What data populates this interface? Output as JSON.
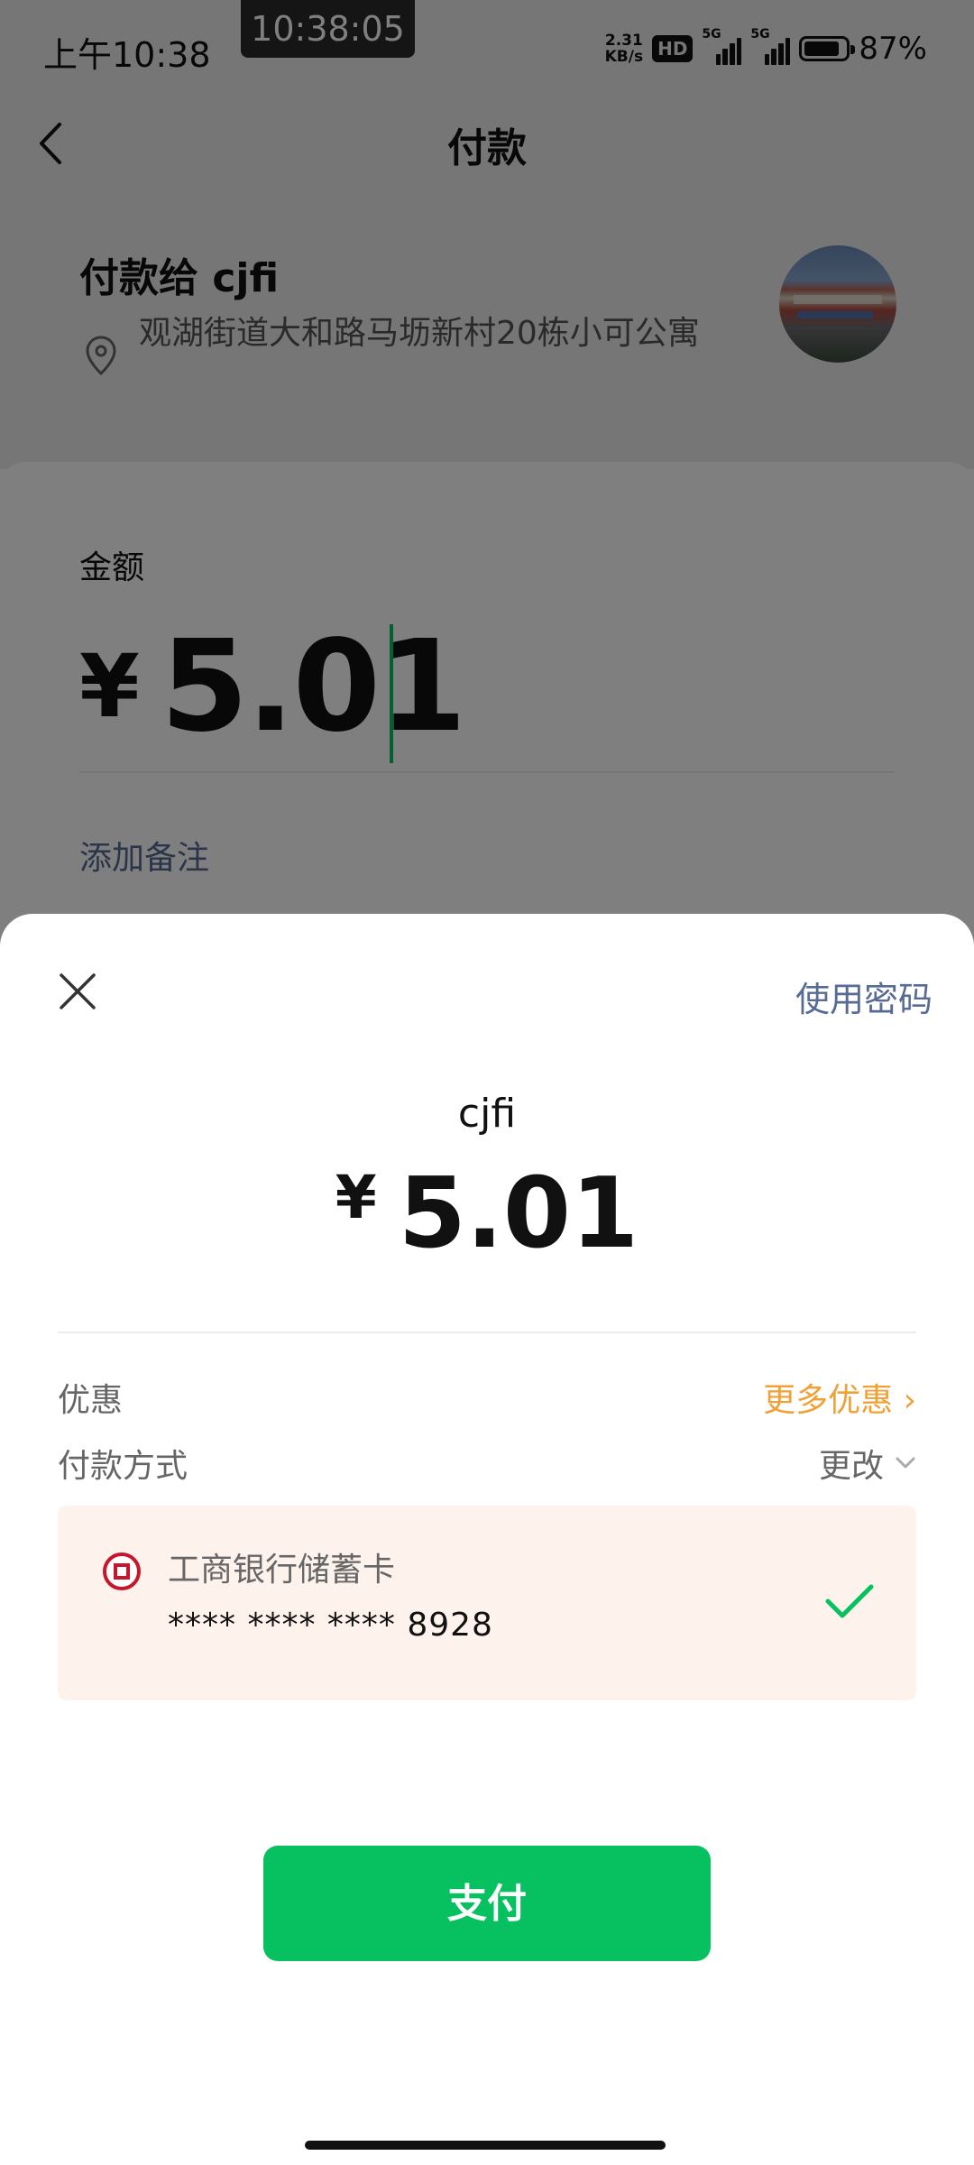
{
  "status_bar": {
    "time": "上午10:38",
    "clock_badge": "10:38:05",
    "net_speed_value": "2.31",
    "net_speed_unit": "KB/s",
    "hd_badge": "HD",
    "signal_label_1": "5G",
    "signal_label_2": "5G",
    "battery_percent": "87%",
    "battery_level": 0.87
  },
  "nav": {
    "title": "付款",
    "back_icon": "chevron-left-icon"
  },
  "payee": {
    "title": "付款给 cjfi",
    "address": "观湖街道大和路马坜新村20栋小可公寓",
    "location_icon": "map-pin-icon",
    "avatar": "storefront-photo"
  },
  "amount_form": {
    "label": "金额",
    "currency": "¥",
    "value": "5.01",
    "add_note": "添加备注"
  },
  "sheet": {
    "close_icon": "close-icon",
    "use_password": "使用密码",
    "payee_name": "cjfi",
    "currency": "¥",
    "amount": "5.01",
    "discount_label": "优惠",
    "more_discount": "更多优惠 ›",
    "method_label": "付款方式",
    "change_method": "更改",
    "card": {
      "bank_name": "工商银行储蓄卡",
      "card_number": "**** **** **** 8928",
      "check_icon": "checkmark-icon"
    },
    "pay_button": "支付"
  },
  "colors": {
    "accent_green": "#07c160",
    "link_blue": "#576b95",
    "discount_orange": "#f0a136",
    "bank_red": "#c7162b"
  }
}
